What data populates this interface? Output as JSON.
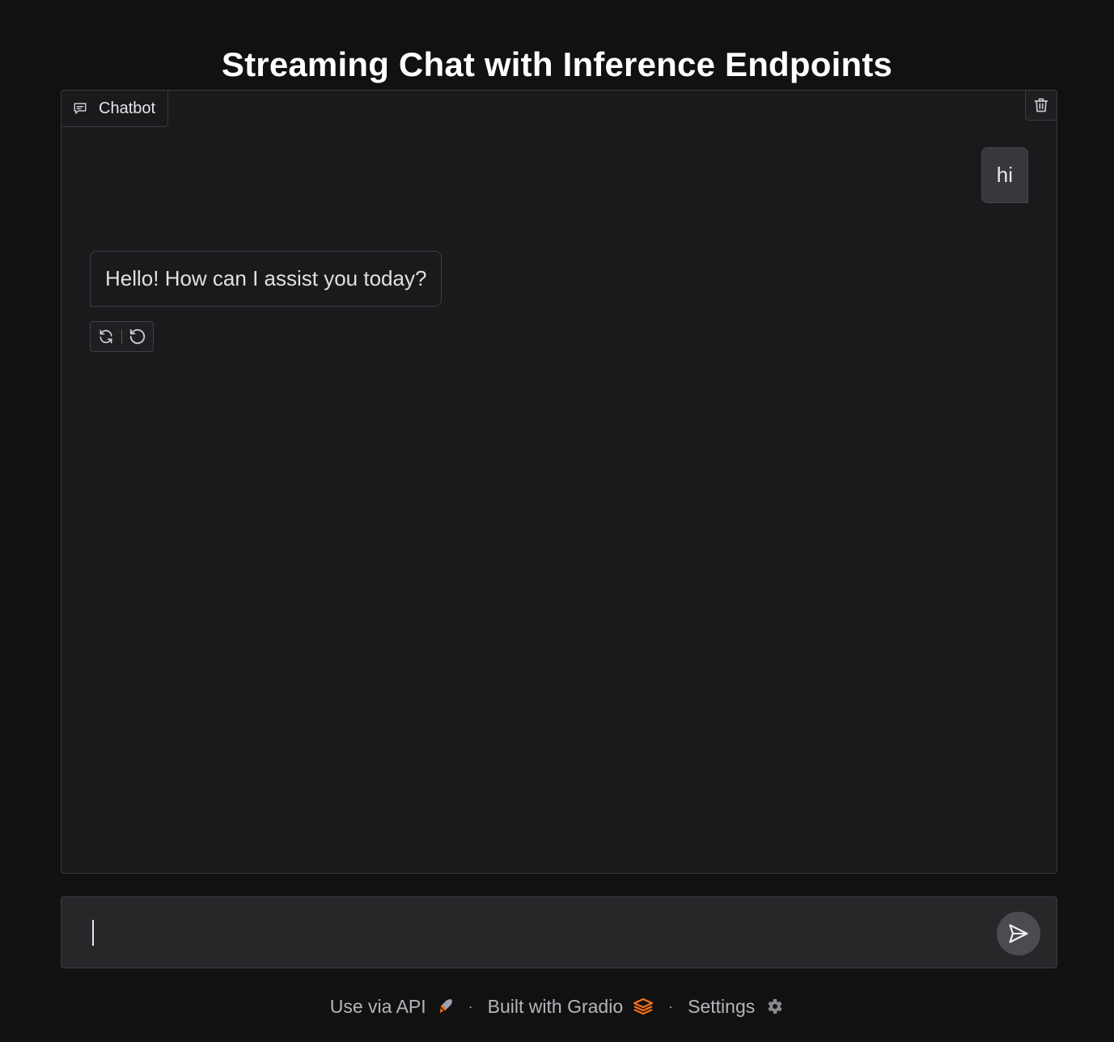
{
  "page": {
    "title": "Streaming Chat with Inference Endpoints"
  },
  "chatbot": {
    "label": "Chatbot",
    "label_icon": "chat-bubble-icon",
    "clear_icon": "trash-icon",
    "messages": [
      {
        "role": "user",
        "text": "hi"
      },
      {
        "role": "assistant",
        "text": "Hello! How can I assist you today?"
      }
    ],
    "actions": [
      {
        "icon": "retry-icon"
      },
      {
        "icon": "undo-icon"
      }
    ]
  },
  "input": {
    "value": "",
    "placeholder": "",
    "submit_icon": "send-icon"
  },
  "footer": {
    "api_label": "Use via API",
    "api_icon": "rocket-icon",
    "separator": "·",
    "gradio_label": "Built with Gradio",
    "gradio_icon": "gradio-logo-icon",
    "settings_label": "Settings",
    "settings_icon": "gear-icon"
  },
  "colors": {
    "background": "#111112",
    "panel": "#1a1a1c",
    "user_bubble": "#37373c",
    "accent_orange": "#f97316"
  }
}
